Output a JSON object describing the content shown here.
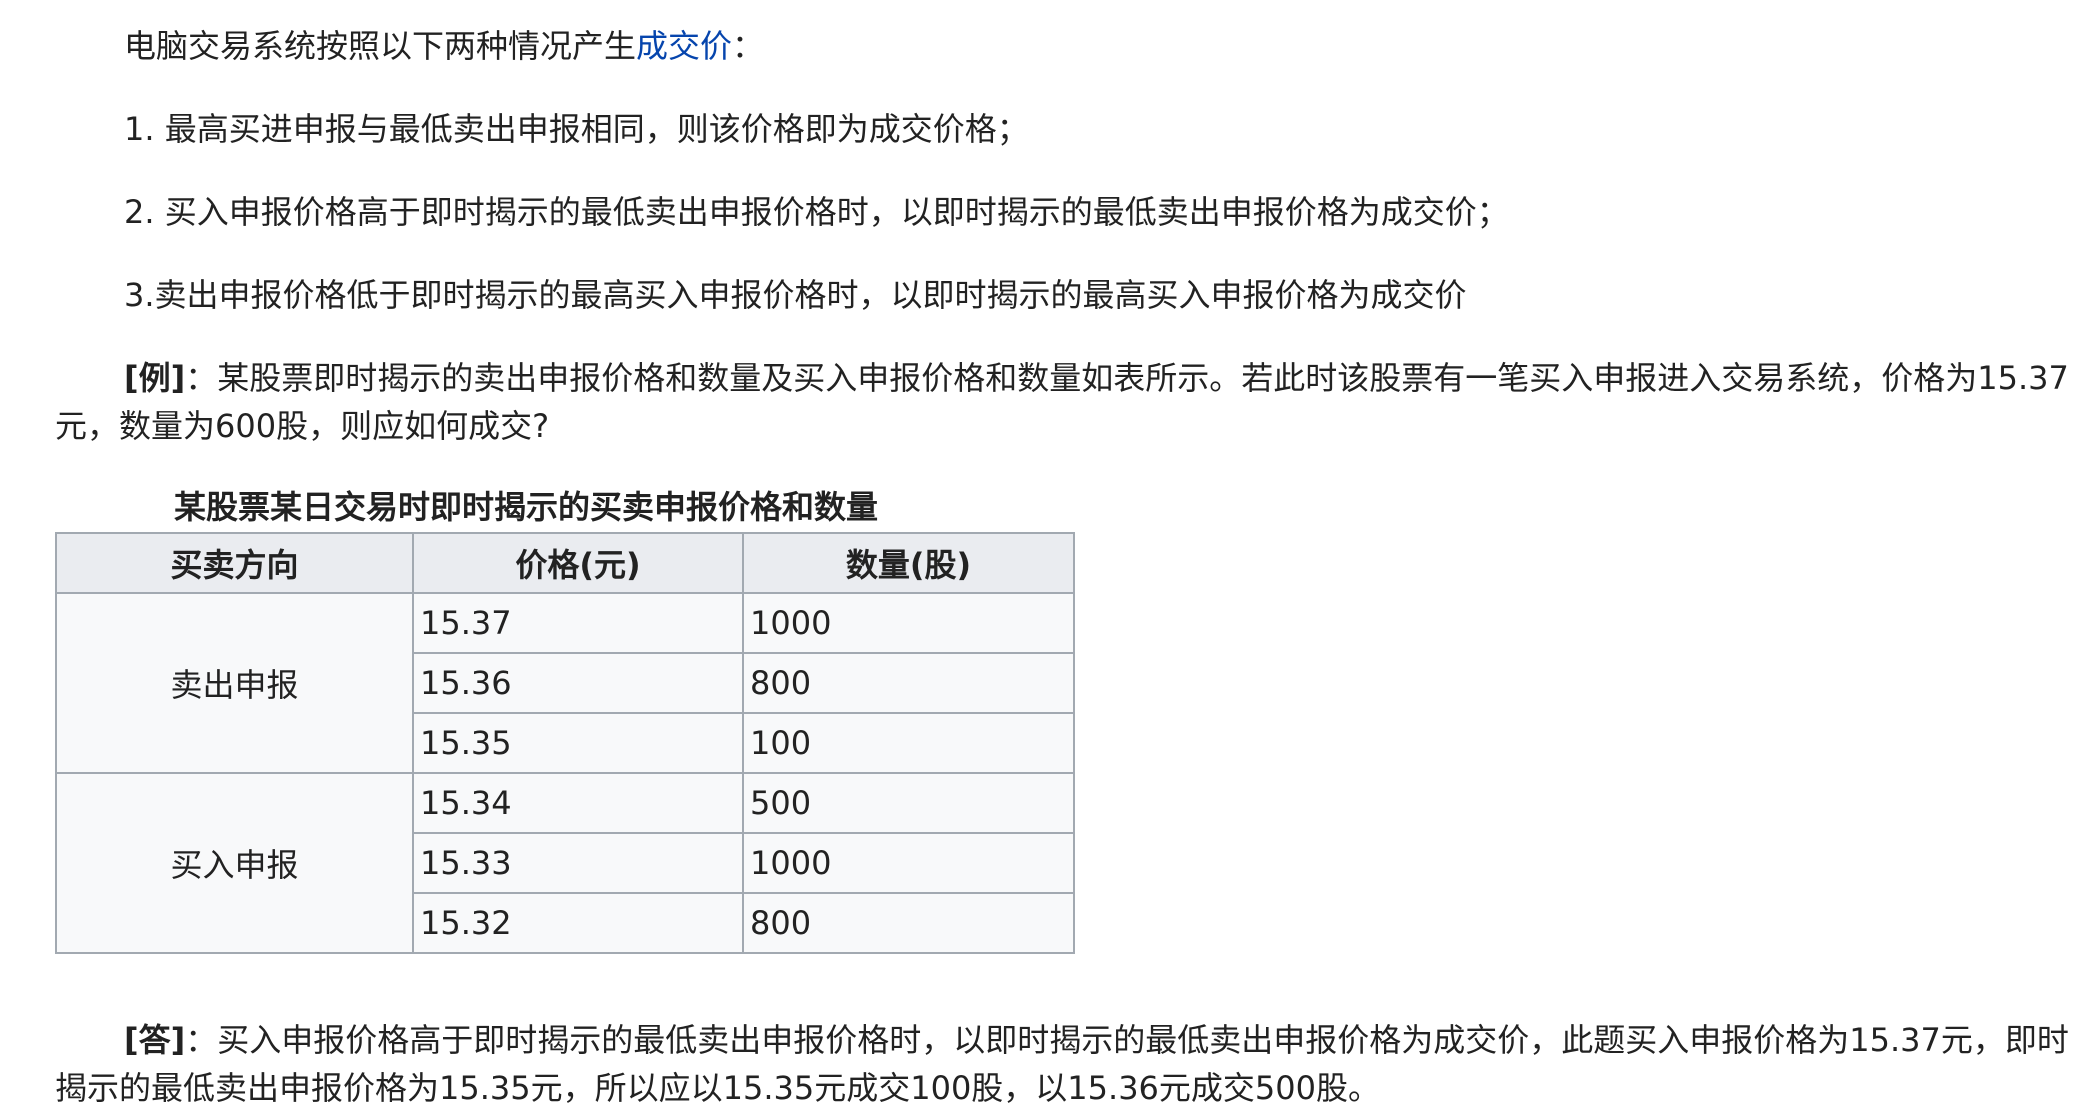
{
  "intro": {
    "prefix": "电脑交易系统按照以下两种情况产生",
    "link": "成交价",
    "suffix": "："
  },
  "rules": [
    "1. 最高买进申报与最低卖出申报相同，则该价格即为成交价格；",
    "2. 买入申报价格高于即时揭示的最低卖出申报价格时，以即时揭示的最低卖出申报价格为成交价；",
    "3.卖出申报价格低于即时揭示的最高买入申报价格时，以即时揭示的最高买入申报价格为成交价"
  ],
  "example": {
    "label": "[例]",
    "text": "：某股票即时揭示的卖出申报价格和数量及买入申报价格和数量如表所示。若此时该股票有一笔买入申报进入交易系统，价格为15.37元，数量为600股，则应如何成交?"
  },
  "table": {
    "caption": "某股票某日交易时即时揭示的买卖申报价格和数量",
    "headers": [
      "买卖方向",
      "价格(元)",
      "数量(股)"
    ],
    "groups": [
      {
        "direction": "卖出申报",
        "rows": [
          {
            "price": "15.37",
            "qty": "1000"
          },
          {
            "price": "15.36",
            "qty": "800"
          },
          {
            "price": "15.35",
            "qty": "100"
          }
        ]
      },
      {
        "direction": "买入申报",
        "rows": [
          {
            "price": "15.34",
            "qty": "500"
          },
          {
            "price": "15.33",
            "qty": "1000"
          },
          {
            "price": "15.32",
            "qty": "800"
          }
        ]
      }
    ]
  },
  "answer": {
    "label": "[答]",
    "text": "：买入申报价格高于即时揭示的最低卖出申报价格时，以即时揭示的最低卖出申报价格为成交价，此题买入申报价格为15.37元，即时揭示的最低卖出申报价格为15.35元，所以应以15.35元成交100股，以15.36元成交500股。"
  },
  "colors": {
    "link": "#0645ad",
    "table_border": "#a2a9b1",
    "header_bg": "#eaecf0",
    "cell_bg": "#f8f9fa"
  }
}
